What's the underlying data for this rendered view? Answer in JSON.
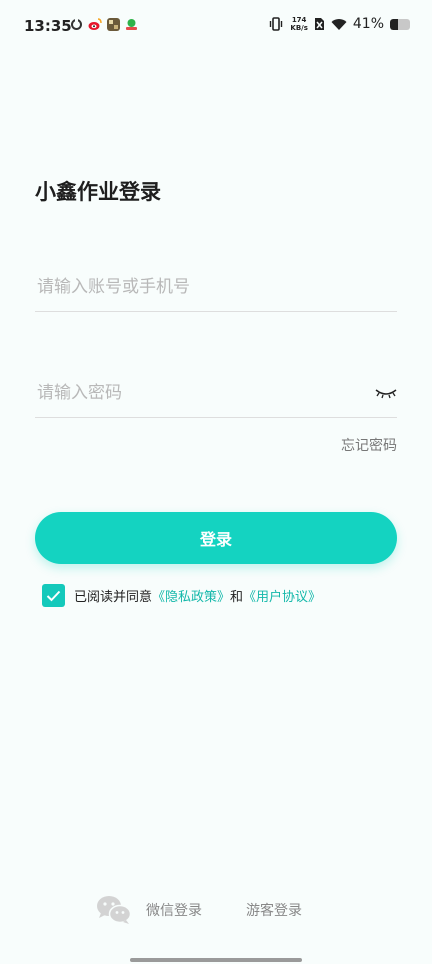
{
  "status_bar": {
    "time": "13:35",
    "net_speed_value": "174",
    "net_speed_unit": "KB/s",
    "battery_percent": "41%",
    "battery_level": 0.41,
    "icons": [
      "sync-icon",
      "weibo-icon",
      "game-icon",
      "app-icon",
      "vibrate-icon",
      "nosim-icon",
      "wifi-icon",
      "battery-icon"
    ]
  },
  "title": "小鑫作业登录",
  "account_field": {
    "placeholder": "请输入账号或手机号",
    "value": ""
  },
  "password_field": {
    "placeholder": "请输入密码",
    "value": ""
  },
  "forgot_password": "忘记密码",
  "login_button": "登录",
  "agreement": {
    "checked": true,
    "prefix": "已阅读并同意",
    "privacy_link": "《隐私政策》",
    "and": "和",
    "user_link": "《用户协议》"
  },
  "bottom": {
    "wechat_login": "微信登录",
    "guest_login": "游客登录"
  },
  "colors": {
    "accent": "#14d3c1",
    "link": "#14b8aa",
    "background": "#f8fdfc"
  }
}
